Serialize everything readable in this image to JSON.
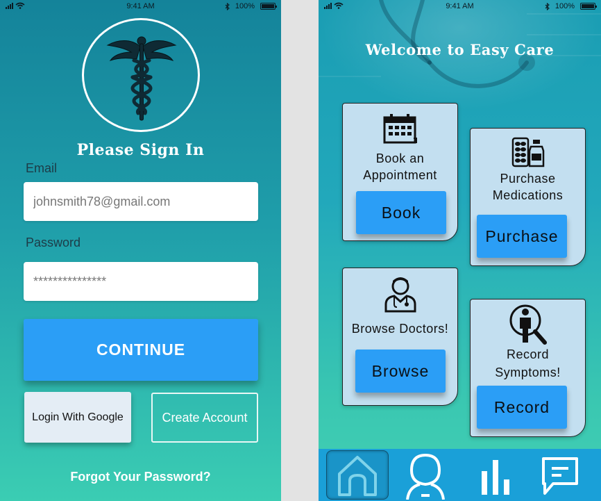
{
  "status_bar": {
    "time": "9:41 AM",
    "battery": "100%"
  },
  "login": {
    "title": "Please Sign In",
    "email_label": "Email",
    "email_value": "johnsmith78@gmail.com",
    "password_label": "Password",
    "password_value": "***************",
    "continue_label": "CONTINUE",
    "google_label": "Login With Google",
    "create_label": "Create Account",
    "forgot_label": "Forgot Your Password?",
    "logo_icon": "caduceus-icon"
  },
  "home": {
    "title": "Welcome to Easy Care",
    "cards": [
      {
        "title_line1": "Book an",
        "title_line2": "Appointment",
        "button": "Book",
        "icon": "calendar-icon"
      },
      {
        "title_line1": "Purchase",
        "title_line2": "Medications",
        "button": "Purchase",
        "icon": "medication-icon"
      },
      {
        "title_line1": "Browse Doctors!",
        "title_line2": "",
        "button": "Browse",
        "icon": "doctor-icon"
      },
      {
        "title_line1": "Record",
        "title_line2": "Symptoms!",
        "button": "Record",
        "icon": "symptom-search-icon"
      }
    ],
    "nav": [
      {
        "name": "home",
        "icon": "home-icon",
        "active": true
      },
      {
        "name": "profile",
        "icon": "person-icon",
        "active": false
      },
      {
        "name": "stats",
        "icon": "bar-chart-icon",
        "active": false
      },
      {
        "name": "messages",
        "icon": "chat-icon",
        "active": false
      }
    ]
  },
  "colors": {
    "accent": "#2b9ef6",
    "nav": "#1aa0d8",
    "card": "#c3dff0",
    "login_top": "#14839a",
    "login_bottom": "#3bcdb3"
  }
}
